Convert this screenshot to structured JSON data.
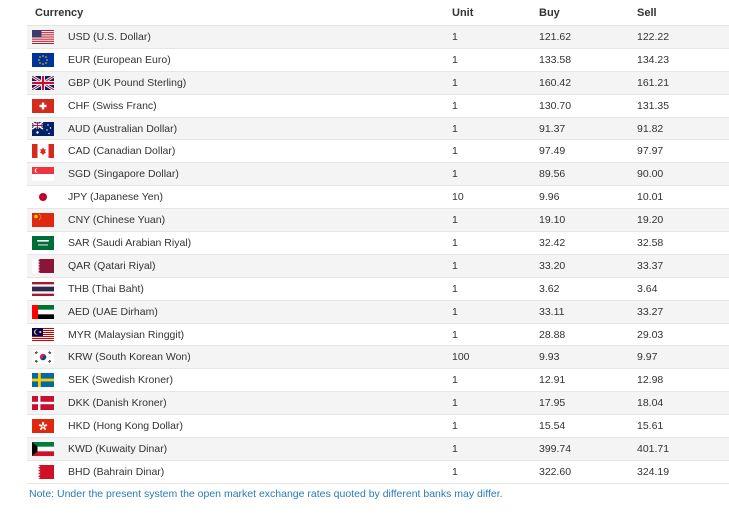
{
  "table": {
    "headers": {
      "currency": "Currency",
      "unit": "Unit",
      "buy": "Buy",
      "sell": "Sell"
    },
    "rows": [
      {
        "flag": "usa-flag-icon",
        "name": "USD (U.S. Dollar)",
        "unit": "1",
        "buy": "121.62",
        "sell": "122.22"
      },
      {
        "flag": "eu-flag-icon",
        "name": "EUR (European Euro)",
        "unit": "1",
        "buy": "133.58",
        "sell": "134.23"
      },
      {
        "flag": "uk-flag-icon",
        "name": "GBP (UK Pound Sterling)",
        "unit": "1",
        "buy": "160.42",
        "sell": "161.21"
      },
      {
        "flag": "switzerland-flag-icon",
        "name": "CHF (Swiss Franc)",
        "unit": "1",
        "buy": "130.70",
        "sell": "131.35"
      },
      {
        "flag": "australia-flag-icon",
        "name": "AUD (Australian Dollar)",
        "unit": "1",
        "buy": "91.37",
        "sell": "91.82"
      },
      {
        "flag": "canada-flag-icon",
        "name": "CAD (Canadian Dollar)",
        "unit": "1",
        "buy": "97.49",
        "sell": "97.97"
      },
      {
        "flag": "singapore-flag-icon",
        "name": "SGD (Singapore Dollar)",
        "unit": "1",
        "buy": "89.56",
        "sell": "90.00"
      },
      {
        "flag": "japan-flag-icon",
        "name": "JPY (Japanese Yen)",
        "unit": "10",
        "buy": "9.96",
        "sell": "10.01"
      },
      {
        "flag": "china-flag-icon",
        "name": "CNY (Chinese Yuan)",
        "unit": "1",
        "buy": "19.10",
        "sell": "19.20"
      },
      {
        "flag": "saudi-arabia-flag-icon",
        "name": "SAR (Saudi Arabian Riyal)",
        "unit": "1",
        "buy": "32.42",
        "sell": "32.58"
      },
      {
        "flag": "qatar-flag-icon",
        "name": "QAR (Qatari Riyal)",
        "unit": "1",
        "buy": "33.20",
        "sell": "33.37"
      },
      {
        "flag": "thailand-flag-icon",
        "name": "THB (Thai Baht)",
        "unit": "1",
        "buy": "3.62",
        "sell": "3.64"
      },
      {
        "flag": "uae-flag-icon",
        "name": "AED (UAE Dirham)",
        "unit": "1",
        "buy": "33.11",
        "sell": "33.27"
      },
      {
        "flag": "malaysia-flag-icon",
        "name": "MYR (Malaysian Ringgit)",
        "unit": "1",
        "buy": "28.88",
        "sell": "29.03"
      },
      {
        "flag": "south-korea-flag-icon",
        "name": "KRW (South Korean Won)",
        "unit": "100",
        "buy": "9.93",
        "sell": "9.97"
      },
      {
        "flag": "sweden-flag-icon",
        "name": "SEK (Swedish Kroner)",
        "unit": "1",
        "buy": "12.91",
        "sell": "12.98"
      },
      {
        "flag": "denmark-flag-icon",
        "name": "DKK (Danish Kroner)",
        "unit": "1",
        "buy": "17.95",
        "sell": "18.04"
      },
      {
        "flag": "hong-kong-flag-icon",
        "name": "HKD (Hong Kong Dollar)",
        "unit": "1",
        "buy": "15.54",
        "sell": "15.61"
      },
      {
        "flag": "kuwait-flag-icon",
        "name": "KWD (Kuwaity Dinar)",
        "unit": "1",
        "buy": "399.74",
        "sell": "401.71"
      },
      {
        "flag": "bahrain-flag-icon",
        "name": "BHD (Bahrain Dinar)",
        "unit": "1",
        "buy": "322.60",
        "sell": "324.19"
      }
    ]
  },
  "note": "Note: Under the present system the open market exchange rates quoted by different banks may differ.",
  "colors": {
    "note": "#2a7ab8",
    "row_alt": "#f4f4f4",
    "border": "#e6e6e6"
  }
}
